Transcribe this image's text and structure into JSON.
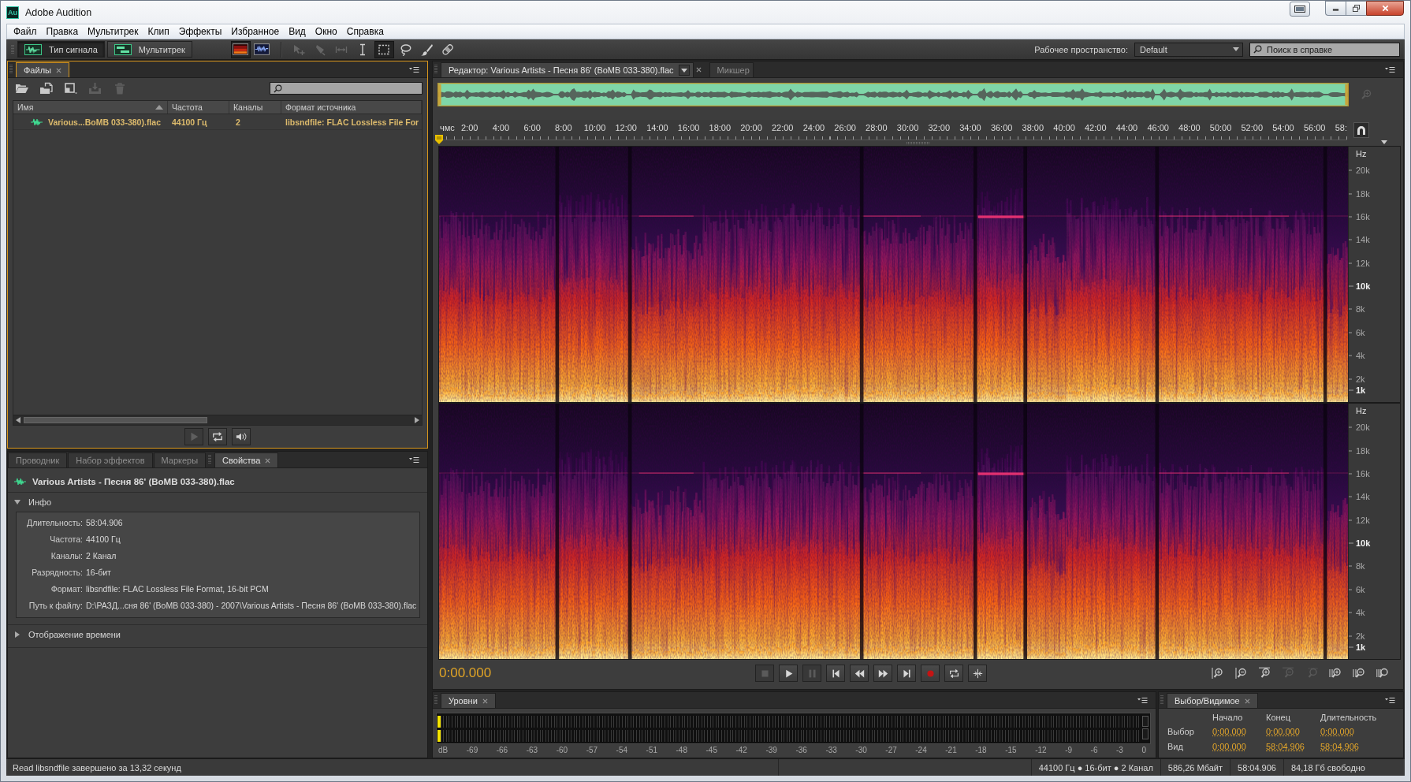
{
  "window": {
    "title": "Adobe Audition",
    "app_icon": "Au"
  },
  "menu": [
    "Файл",
    "Правка",
    "Мультитрек",
    "Клип",
    "Эффекты",
    "Избранное",
    "Вид",
    "Окно",
    "Справка"
  ],
  "toolbar": {
    "view_modes": [
      {
        "label": "Тип сигнала",
        "kind": "waveform",
        "selected": true
      },
      {
        "label": "Мультитрек",
        "kind": "multitrack",
        "selected": false
      }
    ],
    "display_toggles": [
      {
        "kind": "spectral",
        "selected": true
      },
      {
        "kind": "waveform",
        "selected": false
      }
    ],
    "tools": [
      {
        "kind": "move",
        "selected": false,
        "disabled": true
      },
      {
        "kind": "razor",
        "selected": false,
        "disabled": true
      },
      {
        "kind": "slip",
        "selected": false,
        "disabled": true
      },
      {
        "kind": "time-selection",
        "selected": false,
        "disabled": false
      },
      {
        "kind": "marquee",
        "selected": true,
        "disabled": false
      },
      {
        "kind": "lasso",
        "selected": false,
        "disabled": false
      },
      {
        "kind": "brush",
        "selected": false,
        "disabled": false
      },
      {
        "kind": "healing",
        "selected": false,
        "disabled": false
      }
    ],
    "workspace": {
      "label": "Рабочее пространство:",
      "value": "Default"
    },
    "help_search": {
      "placeholder": "Поиск в справке"
    }
  },
  "files_panel": {
    "tab": "Файлы",
    "focused": true,
    "actions": [
      {
        "kind": "open",
        "disabled": false
      },
      {
        "kind": "import",
        "disabled": false
      },
      {
        "kind": "new",
        "disabled": false
      },
      {
        "kind": "insert",
        "disabled": true
      },
      {
        "kind": "delete",
        "disabled": true
      }
    ],
    "columns": [
      {
        "label": "Имя",
        "sorted": true
      },
      {
        "label": "Частота",
        "sorted": false
      },
      {
        "label": "Каналы",
        "sorted": false
      },
      {
        "label": "Формат источника",
        "sorted": false
      }
    ],
    "rows": [
      {
        "name": "Various...BoMB 033-380).flac",
        "sample_rate": "44100 Гц",
        "channels": "2",
        "format": "libsndfile: FLAC Lossless File For"
      }
    ],
    "playback": [
      {
        "kind": "play",
        "disabled": true
      },
      {
        "kind": "loop",
        "disabled": false
      },
      {
        "kind": "autoplay",
        "disabled": false
      }
    ]
  },
  "properties_panel": {
    "tabs": [
      {
        "label": "Проводник",
        "selected": false
      },
      {
        "label": "Набор эффектов",
        "selected": false
      },
      {
        "label": "Маркеры",
        "selected": false
      },
      {
        "label": "Свойства",
        "selected": true
      }
    ],
    "file_name": "Various Artists - Песня 86' (BoMB 033-380).flac",
    "sections": [
      {
        "title": "Инфо",
        "expanded": true,
        "fields": [
          {
            "label": "Длительность:",
            "value": "58:04.906"
          },
          {
            "label": "Частота:",
            "value": "44100 Гц"
          },
          {
            "label": "Каналы:",
            "value": "2 Канал"
          },
          {
            "label": "Разрядность:",
            "value": "16-бит"
          },
          {
            "label": "Формат:",
            "value": "libsndfile: FLAC Lossless File Format, 16-bit PCM"
          },
          {
            "label": "Путь к файлу:",
            "value": "D:\\РАЗД...сня 86' (BoMB 033-380) - 2007\\Various Artists - Песня 86' (BoMB 033-380).flac"
          }
        ]
      },
      {
        "title": "Отображение времени",
        "expanded": false
      }
    ]
  },
  "editor": {
    "tabs": [
      {
        "label": "Редактор: Various Artists - Песня 86' (BoMB 033-380).flac",
        "selected": true
      },
      {
        "label": "Микшер",
        "selected": false
      }
    ],
    "ruler": {
      "unit": "чмс",
      "ticks": [
        "2:00",
        "4:00",
        "6:00",
        "8:00",
        "10:00",
        "12:00",
        "14:00",
        "16:00",
        "18:00",
        "20:00",
        "22:00",
        "24:00",
        "26:00",
        "28:00",
        "30:00",
        "32:00",
        "34:00",
        "36:00",
        "38:00",
        "40:00",
        "42:00",
        "44:00",
        "46:00",
        "48:00",
        "50:00",
        "52:00",
        "54:00",
        "56:00",
        "58:"
      ]
    },
    "channels": [
      {
        "unit": "Hz",
        "ticks": [
          {
            "label": "20k",
            "major": false
          },
          {
            "label": "18k",
            "major": false
          },
          {
            "label": "16k",
            "major": false
          },
          {
            "label": "14k",
            "major": false
          },
          {
            "label": "12k",
            "major": false
          },
          {
            "label": "10k",
            "major": true
          },
          {
            "label": "8k",
            "major": false
          },
          {
            "label": "6k",
            "major": false
          },
          {
            "label": "4k",
            "major": false
          },
          {
            "label": "2k",
            "major": false
          },
          {
            "label": "1k",
            "major": true
          }
        ]
      },
      {
        "unit": "Hz",
        "ticks": [
          {
            "label": "20k",
            "major": false
          },
          {
            "label": "18k",
            "major": false
          },
          {
            "label": "16k",
            "major": false
          },
          {
            "label": "14k",
            "major": false
          },
          {
            "label": "12k",
            "major": false
          },
          {
            "label": "10k",
            "major": true
          },
          {
            "label": "8k",
            "major": false
          },
          {
            "label": "6k",
            "major": false
          },
          {
            "label": "4k",
            "major": false
          },
          {
            "label": "2k",
            "major": false
          },
          {
            "label": "1k",
            "major": true
          }
        ]
      }
    ],
    "current_time": "0:00.000",
    "transport": [
      {
        "kind": "stop",
        "disabled": true
      },
      {
        "kind": "play",
        "disabled": false
      },
      {
        "kind": "pause",
        "disabled": true
      },
      {
        "kind": "to-start",
        "disabled": false
      },
      {
        "kind": "rewind",
        "disabled": false
      },
      {
        "kind": "forward",
        "disabled": false
      },
      {
        "kind": "to-end",
        "disabled": false
      },
      {
        "kind": "record",
        "disabled": false
      },
      {
        "kind": "loop",
        "disabled": false
      },
      {
        "kind": "skip",
        "disabled": false
      }
    ],
    "zoom_controls": [
      {
        "kind": "amp-in",
        "disabled": false
      },
      {
        "kind": "amp-out",
        "disabled": false
      },
      {
        "kind": "in-point",
        "disabled": false
      },
      {
        "kind": "out-point",
        "disabled": true
      },
      {
        "kind": "selection",
        "disabled": true
      },
      {
        "kind": "time-in",
        "disabled": false
      },
      {
        "kind": "time-out",
        "disabled": false
      },
      {
        "kind": "full",
        "disabled": false
      }
    ]
  },
  "levels_panel": {
    "tab": "Уровни",
    "meters": [
      {
        "level": 0.004
      },
      {
        "level": 0.004
      }
    ],
    "scale": [
      "dB",
      "-69",
      "-66",
      "-63",
      "-60",
      "-57",
      "-54",
      "-51",
      "-48",
      "-45",
      "-42",
      "-39",
      "-36",
      "-33",
      "-30",
      "-27",
      "-24",
      "-21",
      "-18",
      "-15",
      "-12",
      "-9",
      "-6",
      "-3",
      "0"
    ]
  },
  "selection_panel": {
    "tab": "Выбор/Видимое",
    "columns": [
      "Начало",
      "Конец",
      "Длительность"
    ],
    "rows": [
      {
        "label": "Выбор",
        "values": [
          "0:00.000",
          "0:00.000",
          "0:00.000"
        ]
      },
      {
        "label": "Вид",
        "values": [
          "0:00.000",
          "58:04.906",
          "58:04.906"
        ]
      }
    ]
  },
  "status_bar": {
    "message": "Read libsndfile завершено за 13,32 секунд",
    "segments": [
      "44100 Гц ● 16-бит ● 2 Канал",
      "586,26 Мбайт",
      "58:04.906",
      "84,18 Гб свободно"
    ]
  }
}
